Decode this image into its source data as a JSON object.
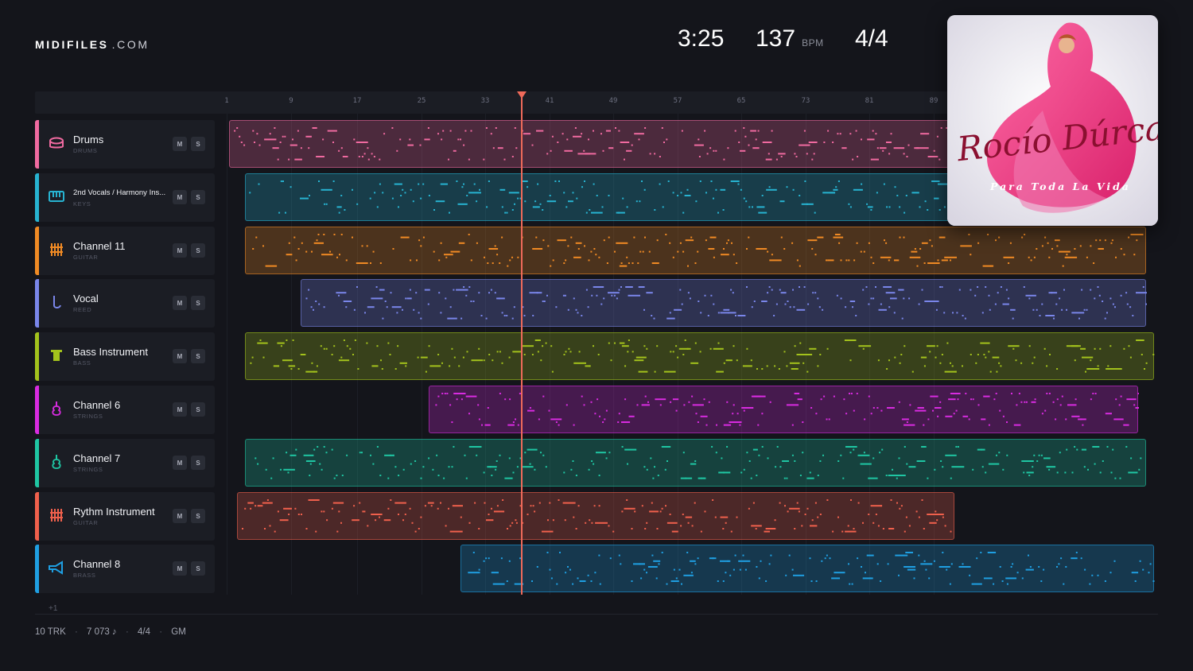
{
  "brand": {
    "main": "MIDIFILES",
    "suffix": ".COM"
  },
  "transport": {
    "time": "3:25",
    "bpm": "137",
    "bpm_unit": "BPM",
    "meter": "4/4"
  },
  "ruler": {
    "ticks": [
      "1",
      "9",
      "17",
      "25",
      "33",
      "41",
      "49",
      "57",
      "65",
      "73",
      "81",
      "89"
    ],
    "playhead_bar": 34
  },
  "tracks": [
    {
      "name": "Drums",
      "category": "DRUMS",
      "color": "#f06aa0",
      "icon": "drum-icon",
      "mute": "M",
      "solo": "S"
    },
    {
      "name": "2nd Vocals / Harmony Ins...",
      "category": "KEYS",
      "color": "#27b3d1",
      "icon": "keyboard-icon",
      "mute": "M",
      "solo": "S"
    },
    {
      "name": "Channel 11",
      "category": "GUITAR",
      "color": "#f08a24",
      "icon": "guitar-grid-icon",
      "mute": "M",
      "solo": "S"
    },
    {
      "name": "Vocal",
      "category": "REED",
      "color": "#7a86ea",
      "icon": "saxophone-icon",
      "mute": "M",
      "solo": "S"
    },
    {
      "name": "Bass Instrument",
      "category": "BASS",
      "color": "#a3c21c",
      "icon": "bass-icon",
      "mute": "M",
      "solo": "S"
    },
    {
      "name": "Channel 6",
      "category": "STRINGS",
      "color": "#d82be0",
      "icon": "violin-icon",
      "mute": "M",
      "solo": "S"
    },
    {
      "name": "Channel 7",
      "category": "STRINGS",
      "color": "#1fc6a3",
      "icon": "violin-icon",
      "mute": "M",
      "solo": "S"
    },
    {
      "name": "Rythm Instrument",
      "category": "GUITAR",
      "color": "#f0604c",
      "icon": "guitar-grid-icon",
      "mute": "M",
      "solo": "S"
    },
    {
      "name": "Channel 8",
      "category": "BRASS",
      "color": "#1f9fe2",
      "icon": "trumpet-icon",
      "mute": "M",
      "solo": "S"
    }
  ],
  "more_tracks": "+1",
  "footer": {
    "tracks": "10 TRK",
    "notes": "7 073 ♪",
    "meter": "4/4",
    "format": "GM"
  },
  "cover": {
    "artist": "Rocío Dúrcal",
    "album": "Para Toda La Vida"
  }
}
